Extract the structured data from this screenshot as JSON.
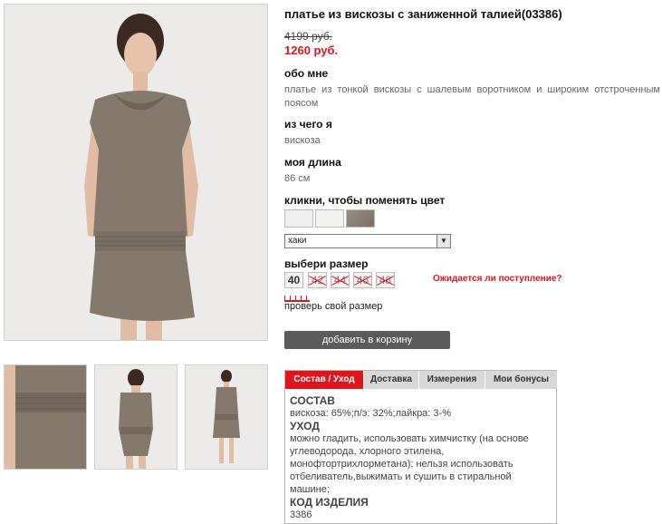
{
  "product": {
    "title": "платье из вискозы с заниженной талией(03386)",
    "old_price": "4199 руб.",
    "new_price": "1260 руб."
  },
  "about": {
    "label": "обо мне",
    "text": "платье из тонкой вискозы с шалевым воротником и широким отстроченным поясом"
  },
  "material": {
    "label": "из чего я",
    "text": "вискоза"
  },
  "length": {
    "label": "моя длина",
    "text": "86 см"
  },
  "color": {
    "label": "кликни, чтобы поменять цвет",
    "swatches": [
      {
        "name": "white",
        "color": "#eeeeee"
      },
      {
        "name": "off-white",
        "color": "#f4f3f1"
      },
      {
        "name": "khaki",
        "color": "#8d8274"
      }
    ],
    "selected": "хаки"
  },
  "size": {
    "label": "выбери размер",
    "options": [
      {
        "label": "40",
        "available": true
      },
      {
        "label": "42",
        "available": false
      },
      {
        "label": "44",
        "available": false
      },
      {
        "label": "46",
        "available": false
      },
      {
        "label": "48",
        "available": false
      }
    ],
    "notify_link": "Ожидается ли поступление?",
    "check_size_link": "проверь свой размер"
  },
  "cart": {
    "button_label": "добавить в корзину"
  },
  "tabs": {
    "items": [
      {
        "label": "Состав / Уход",
        "active": true
      },
      {
        "label": "Доставка",
        "active": false
      },
      {
        "label": "Измерения",
        "active": false
      },
      {
        "label": "Мои бонусы",
        "active": false
      }
    ],
    "content": {
      "composition_heading": "СОСТАВ",
      "composition_text": "вискоза: 65%;п/э: 32%;лайкра: 3-%",
      "care_heading": "УХОД",
      "care_text": "можно гладить, использовать химчистку (на основе углеводорода, хлорного этилена, монофтортрихлорметана); нельзя использовать отбеливатель,выжимать и сушить в стиральной машине;",
      "code_heading": "КОД ИЗДЕЛИЯ",
      "code_text": "3386"
    }
  },
  "colors": {
    "accent": "#e0141b",
    "button": "#5b5b5b",
    "dress": "#85796c"
  }
}
